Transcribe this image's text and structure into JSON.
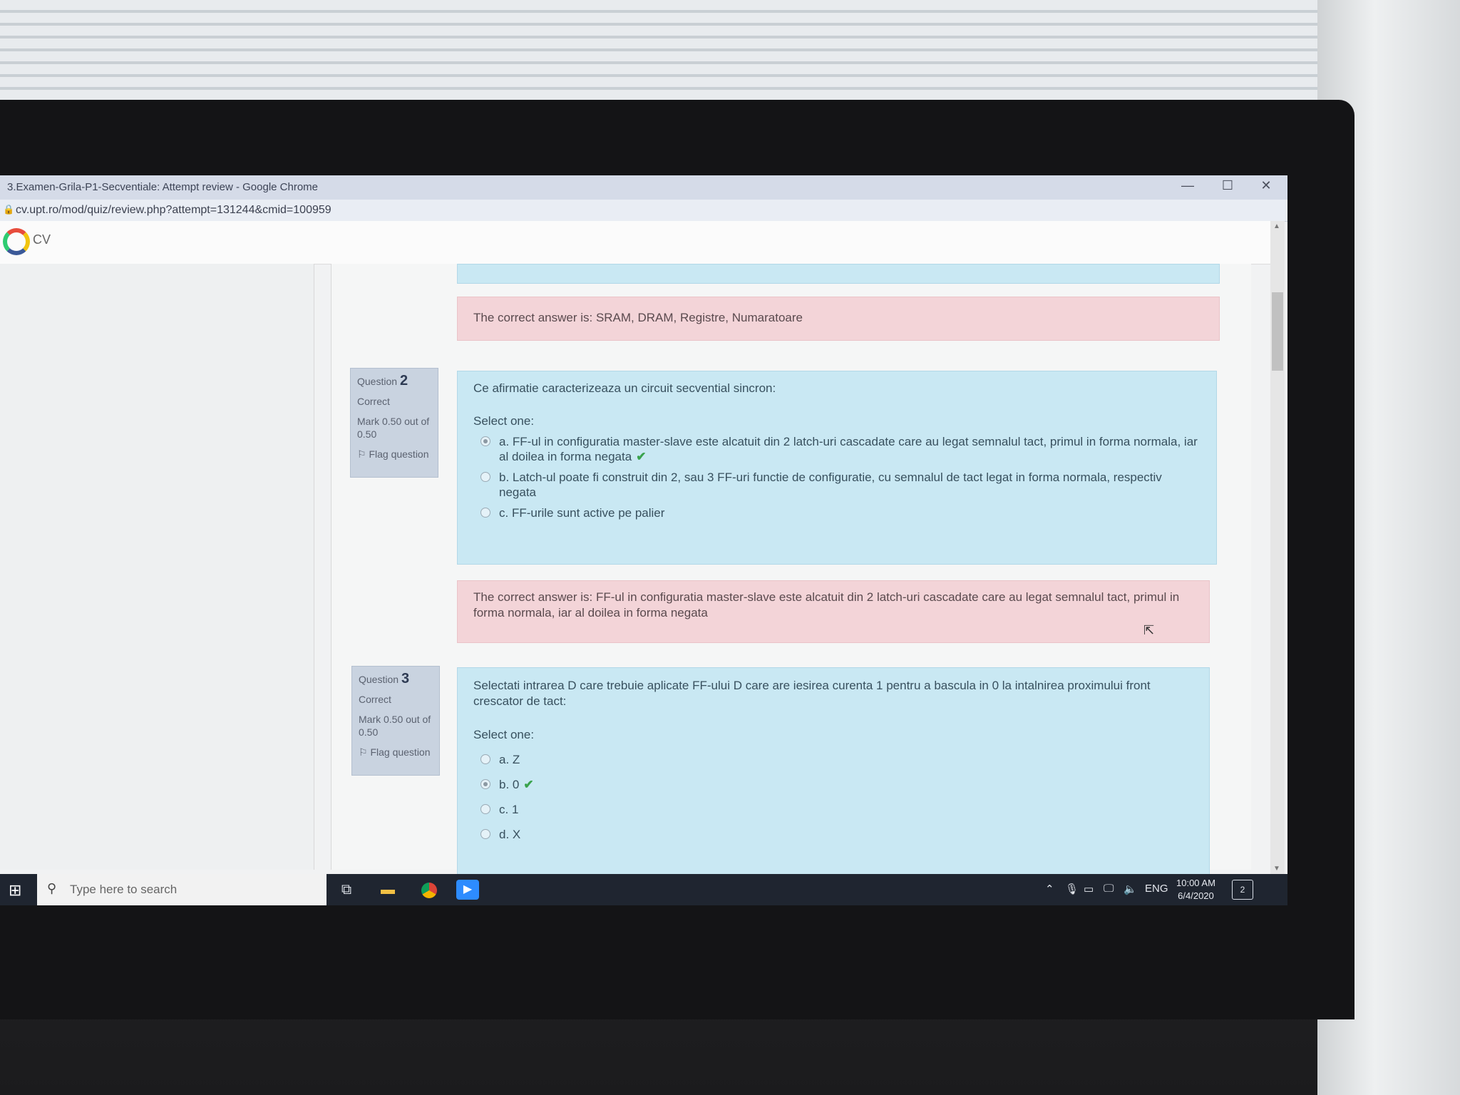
{
  "browser": {
    "title": "3.Examen-Grila-P1-Secventiale: Attempt review - Google Chrome",
    "url": "cv.upt.ro/mod/quiz/review.php?attempt=131244&cmid=100959",
    "controls": {
      "minimize": "—",
      "maximize": "☐",
      "close": "✕"
    }
  },
  "site": {
    "logo_text": "CV"
  },
  "question1": {
    "correct_answer": "The correct answer is: SRAM, DRAM, Registre, Numaratoare"
  },
  "question2": {
    "label": "Question",
    "number": "2",
    "status": "Correct",
    "mark": "Mark 0.50 out of 0.50",
    "flag": "Flag question",
    "text": "Ce afirmatie caracterizeaza un circuit secvential sincron:",
    "select_one": "Select one:",
    "answers": [
      {
        "text": "a. FF-ul in configuratia master-slave este alcatuit din 2 latch-uri cascadate care au legat semnalul tact, primul in forma normala, iar al doilea in forma negata",
        "checked": true,
        "correct": true
      },
      {
        "text": "b. Latch-ul poate fi construit din 2, sau 3 FF-uri functie de configuratie, cu semnalul de tact legat in forma normala, respectiv negata",
        "checked": false,
        "correct": false
      },
      {
        "text": "c. FF-urile sunt active pe palier",
        "checked": false,
        "correct": false
      }
    ],
    "correct_answer": "The correct answer is: FF-ul in configuratia master-slave este alcatuit din 2 latch-uri cascadate care au legat semnalul tact, primul in forma normala, iar al doilea in forma negata"
  },
  "question3": {
    "label": "Question",
    "number": "3",
    "status": "Correct",
    "mark": "Mark 0.50 out of 0.50",
    "flag": "Flag question",
    "text": "Selectati intrarea D care trebuie aplicate FF-ului D care are iesirea curenta 1 pentru a bascula in 0 la intalnirea proximului front crescator de tact:",
    "select_one": "Select one:",
    "answers": [
      {
        "text": "a. Z",
        "checked": false
      },
      {
        "text": "b. 0",
        "checked": true
      },
      {
        "text": "c. 1",
        "checked": false
      },
      {
        "text": "d. X",
        "checked": false
      }
    ]
  },
  "taskbar": {
    "search_placeholder": "Type here to search",
    "language": "ENG",
    "time": "10:00 AM",
    "date": "6/4/2020",
    "notifications": "2"
  },
  "colors": {
    "formulation_bg": "#c9e8f3",
    "outcome_bg": "#f3d4d8",
    "info_bg": "#c9d3e0",
    "check_green": "#3aa34d"
  }
}
